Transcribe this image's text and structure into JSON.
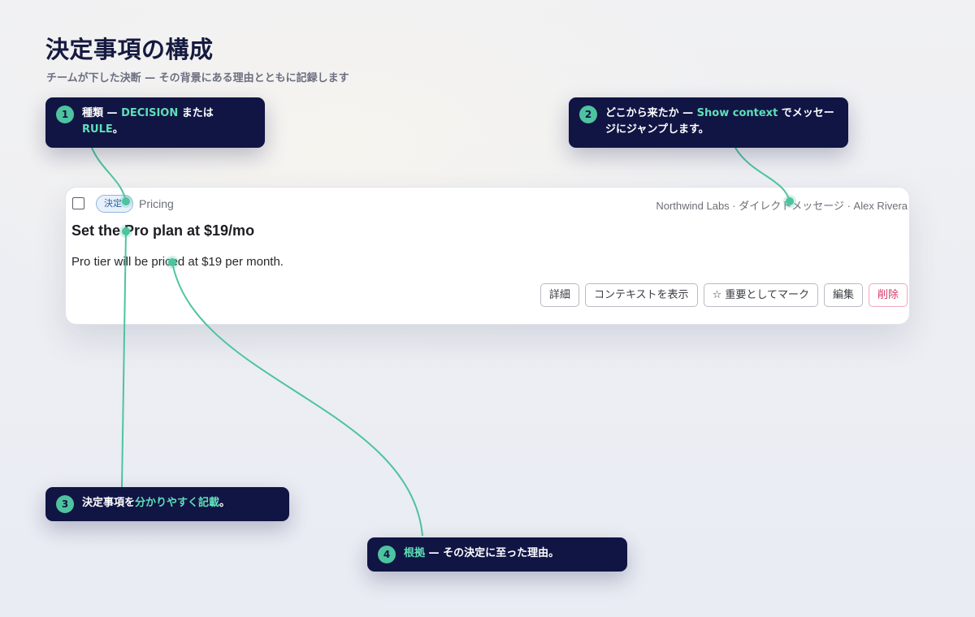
{
  "page": {
    "title": "決定事項の構成",
    "subtitle": "チームが下した決断 — その背景にある理由とともに記録します"
  },
  "card": {
    "type_badge": "決定",
    "topic": "Pricing",
    "source_meta": "Northwind Labs · ダイレクトメッセージ · Alex Rivera",
    "title": "Set the Pro plan at $19/mo",
    "rationale": "Pro tier will be priced at $19 per month.",
    "actions": {
      "details": "詳細",
      "show_context": "コンテキストを表示",
      "mark_important": "☆ 重要としてマーク",
      "edit": "編集",
      "delete": "削除"
    }
  },
  "callouts": [
    {
      "number": "1",
      "pre": "種類 — ",
      "hl1": "DECISION",
      "mid": " または ",
      "hl2": "RULE",
      "post": "。"
    },
    {
      "number": "2",
      "pre": "どこから来たか — ",
      "hl1": "Show context",
      "post": " でメッセージにジャンプします。"
    },
    {
      "number": "3",
      "pre": "決定事項を",
      "hl1": "分かりやすく記載",
      "post": "。"
    },
    {
      "number": "4",
      "hl1": "根拠",
      "post": " — その決定に至った理由。"
    }
  ],
  "colors": {
    "callout_bg": "#111544",
    "accent": "#4ec3a0",
    "highlight": "#5ee0b8",
    "danger": "#d63a6a"
  }
}
